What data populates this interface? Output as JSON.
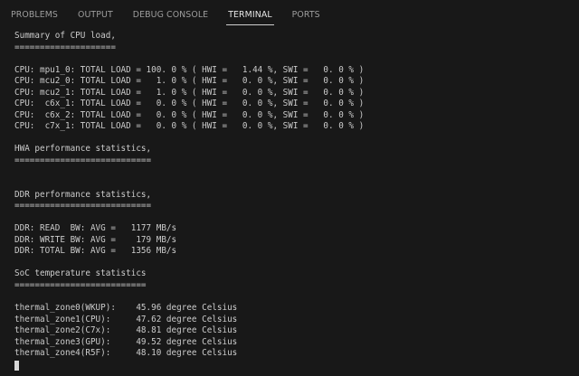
{
  "colors": {
    "background": "#181818",
    "text": "#cccccc",
    "tab_inactive": "#9d9d9d",
    "tab_active": "#e7e7e7"
  },
  "tabs": [
    {
      "label": "PROBLEMS",
      "active": false
    },
    {
      "label": "OUTPUT",
      "active": false
    },
    {
      "label": "DEBUG CONSOLE",
      "active": false
    },
    {
      "label": "TERMINAL",
      "active": true
    },
    {
      "label": "PORTS",
      "active": false
    }
  ],
  "terminal": {
    "lines": [
      "Summary of CPU load,",
      "====================",
      "",
      "CPU: mpu1_0: TOTAL LOAD = 100. 0 % ( HWI =   1.44 %, SWI =   0. 0 % )",
      "CPU: mcu2_0: TOTAL LOAD =   1. 0 % ( HWI =   0. 0 %, SWI =   0. 0 % )",
      "CPU: mcu2_1: TOTAL LOAD =   1. 0 % ( HWI =   0. 0 %, SWI =   0. 0 % )",
      "CPU:  c6x_1: TOTAL LOAD =   0. 0 % ( HWI =   0. 0 %, SWI =   0. 0 % )",
      "CPU:  c6x_2: TOTAL LOAD =   0. 0 % ( HWI =   0. 0 %, SWI =   0. 0 % )",
      "CPU:  c7x_1: TOTAL LOAD =   0. 0 % ( HWI =   0. 0 %, SWI =   0. 0 % )",
      "",
      "HWA performance statistics,",
      "===========================",
      "",
      "",
      "DDR performance statistics,",
      "===========================",
      "",
      "DDR: READ  BW: AVG =   1177 MB/s",
      "DDR: WRITE BW: AVG =    179 MB/s",
      "DDR: TOTAL BW: AVG =   1356 MB/s",
      "",
      "SoC temperature statistics",
      "==========================",
      "",
      "thermal_zone0(WKUP):    45.96 degree Celsius",
      "thermal_zone1(CPU):     47.62 degree Celsius",
      "thermal_zone2(C7x):     48.81 degree Celsius",
      "thermal_zone3(GPU):     49.52 degree Celsius",
      "thermal_zone4(R5F):     48.10 degree Celsius"
    ]
  }
}
